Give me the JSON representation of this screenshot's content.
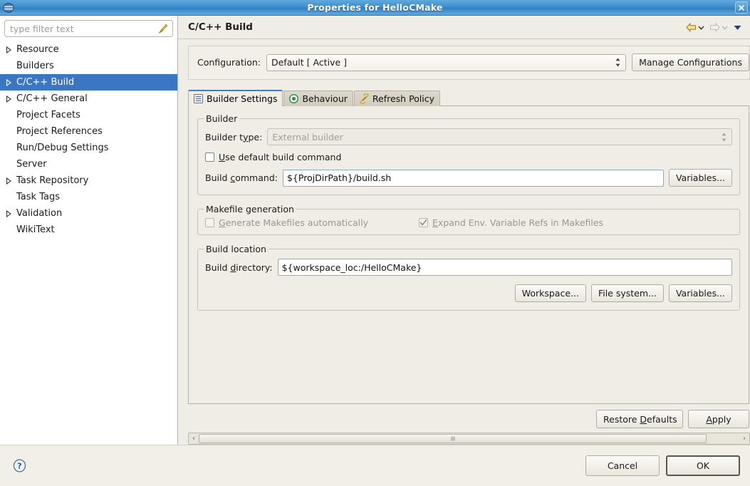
{
  "window": {
    "title": "Properties for HelloCMake",
    "app_icon": "eclipse-globe-icon",
    "close_label": "×"
  },
  "sidebar": {
    "filter": {
      "value": "",
      "placeholder": "type filter text",
      "clear_icon": "broom-icon"
    },
    "items": [
      {
        "label": "Resource",
        "expandable": true,
        "selected": false
      },
      {
        "label": "Builders",
        "expandable": false,
        "selected": false
      },
      {
        "label": "C/C++ Build",
        "expandable": true,
        "selected": true
      },
      {
        "label": "C/C++ General",
        "expandable": true,
        "selected": false
      },
      {
        "label": "Project Facets",
        "expandable": false,
        "selected": false
      },
      {
        "label": "Project References",
        "expandable": false,
        "selected": false
      },
      {
        "label": "Run/Debug Settings",
        "expandable": false,
        "selected": false
      },
      {
        "label": "Server",
        "expandable": false,
        "selected": false
      },
      {
        "label": "Task Repository",
        "expandable": true,
        "selected": false
      },
      {
        "label": "Task Tags",
        "expandable": false,
        "selected": false
      },
      {
        "label": "Validation",
        "expandable": true,
        "selected": false
      },
      {
        "label": "WikiText",
        "expandable": false,
        "selected": false
      }
    ]
  },
  "page": {
    "title": "C/C++ Build",
    "nav": {
      "back_icon": "back-arrow-icon",
      "back_caret_icon": "chevron-down-icon",
      "forward_icon": "forward-arrow-icon",
      "forward_caret_icon": "chevron-down-icon",
      "menu_icon": "view-menu-chevron-icon"
    },
    "configuration": {
      "label": "Configuration:",
      "selected": "Default  [ Active ]",
      "manage_button": "Manage Configurations"
    },
    "tabs": [
      {
        "label": "Builder Settings",
        "icon": "builder-settings-icon",
        "active": true
      },
      {
        "label": "Behaviour",
        "icon": "behaviour-target-icon",
        "active": false
      },
      {
        "label": "Refresh Policy",
        "icon": "refresh-link-icon",
        "active": false
      }
    ],
    "builder_group": {
      "title": "Builder",
      "builder_type_label": "Builder type:",
      "builder_type_value": "External builder",
      "builder_type_disabled": true,
      "use_default_label": "Use default build command",
      "use_default_checked": false,
      "build_command_label": "Build command:",
      "build_command_value": "${ProjDirPath}/build.sh",
      "variables_button": "Variables..."
    },
    "makefile_group": {
      "title": "Makefile generation",
      "generate_label": "Generate Makefiles automatically",
      "generate_checked": false,
      "generate_disabled": true,
      "expand_label": "Expand Env. Variable Refs in Makefiles",
      "expand_checked": true,
      "expand_disabled": true
    },
    "build_location_group": {
      "title": "Build location",
      "build_dir_label": "Build directory:",
      "build_dir_value": "${workspace_loc:/HelloCMake}",
      "workspace_button": "Workspace...",
      "filesystem_button": "File system...",
      "variables_button": "Variables..."
    },
    "restore_defaults_button": "Restore Defaults",
    "apply_button": "Apply",
    "scrollbar": {
      "left_arrow": "‹",
      "right_arrow": "›"
    }
  },
  "footer": {
    "help_icon": "help-question-icon",
    "cancel_button": "Cancel",
    "ok_button": "OK"
  },
  "colors": {
    "titlebar_blue": "#3f8fcd",
    "selection_blue": "#3b76c4",
    "dialog_bg": "#f0ede6",
    "tab_active_underline": "#3f7fc1"
  }
}
